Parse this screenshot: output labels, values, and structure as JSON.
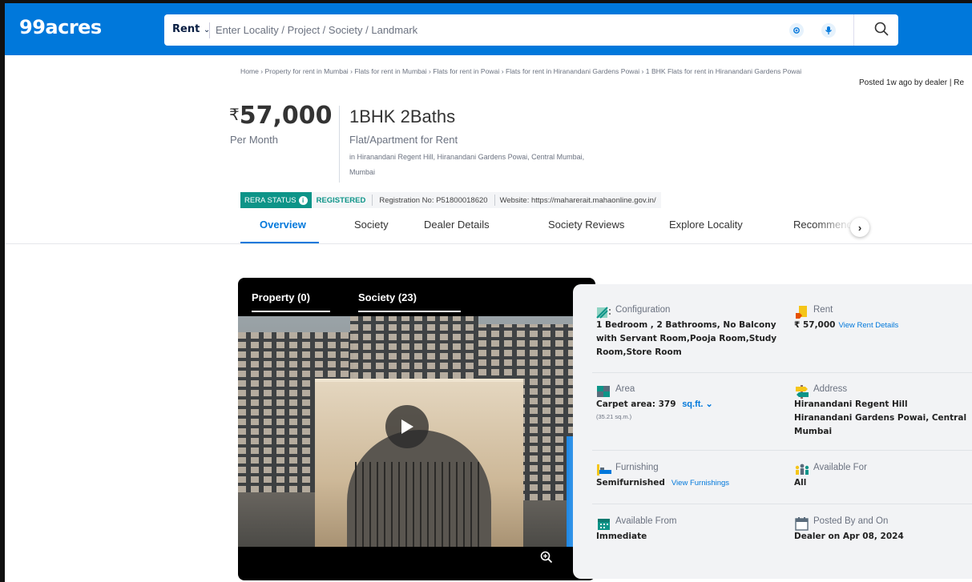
{
  "header": {
    "logo": "99acres",
    "search": {
      "mode": "Rent",
      "placeholder": "Enter Locality / Project / Society / Landmark"
    },
    "icons": [
      "location-icon",
      "mic-icon",
      "search-icon"
    ]
  },
  "breadcrumb": "Home › Property for rent in Mumbai › Flats for rent in Mumbai › Flats for rent in Powai › Flats for rent in Hiranandani Gardens Powai › 1 BHK Flats for rent in Hiranandani Gardens Powai",
  "posted": "Posted 1w ago by dealer  |  Re",
  "listing": {
    "currency": "₹",
    "price": "57,000",
    "price_period": "Per Month",
    "title": "1BHK 2Baths",
    "property_type": "Flat/Apartment for Rent",
    "address_line1": "in Hiranandani Regent Hill, Hiranandani Gardens Powai, Central Mumbai,",
    "address_line2": "Mumbai"
  },
  "rera": {
    "status_label": "RERA STATUS",
    "status_value": "REGISTERED",
    "registration": "Registration No: P51800018620",
    "website": "Website: https://maharerait.mahaonline.gov.in/"
  },
  "tabs": [
    "Overview",
    "Society",
    "Dealer Details",
    "Society Reviews",
    "Explore Locality",
    "Recommenda"
  ],
  "media": {
    "tabs": [
      "Property (0)",
      "Society (23)"
    ]
  },
  "details": {
    "configuration": {
      "label": "Configuration",
      "value_line1": "1 Bedroom , 2 Bathrooms, No Balcony",
      "value_line2": "with Servant Room,Pooja Room,Study",
      "value_line3": "Room,Store Room"
    },
    "rent": {
      "label": "Rent",
      "value": "₹ 57,000",
      "link": "View Rent Details"
    },
    "area": {
      "label": "Area",
      "value": "Carpet area: 379",
      "unit": "sq.ft.",
      "sub": "(35.21 sq.m.)"
    },
    "address": {
      "label": "Address",
      "value_line1": "Hiranandani Regent Hill",
      "value_line2": "Hiranandani Gardens Powai, Central",
      "value_line3": "Mumbai"
    },
    "furnishing": {
      "label": "Furnishing",
      "value": "Semifurnished",
      "link": "View Furnishings"
    },
    "available_for": {
      "label": "Available For",
      "value": "All"
    },
    "available_from": {
      "label": "Available From",
      "value": "Immediate"
    },
    "posted_by": {
      "label": "Posted By and On",
      "value": "Dealer on Apr 08, 2024"
    }
  },
  "colors": {
    "brand": "#0078db",
    "rera": "#0d9488"
  }
}
